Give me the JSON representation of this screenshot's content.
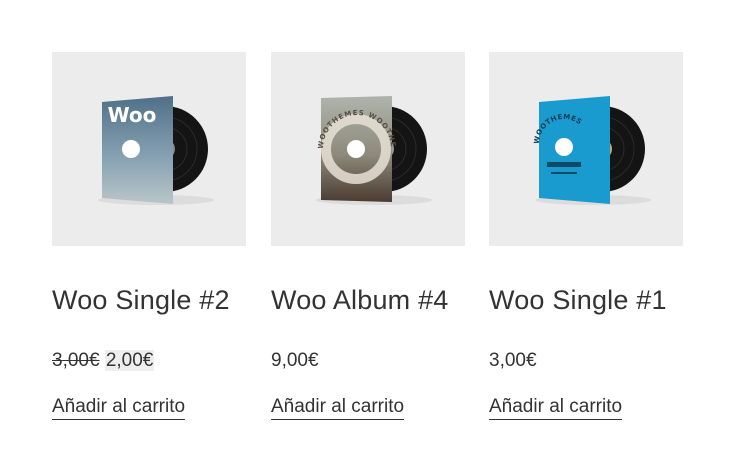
{
  "products": [
    {
      "title": "Woo Single #2",
      "price_regular": "3,00€",
      "price_sale": "2,00€",
      "add_to_cart": "Añadir al carrito",
      "cover_text": "Woo",
      "icon": "vinyl-record-woo-single-2"
    },
    {
      "title": "Woo Album #4",
      "price": "9,00€",
      "add_to_cart": "Añadir al carrito",
      "cover_text": "WOOTHEMES WOOTHEMES",
      "icon": "vinyl-record-woo-album-4"
    },
    {
      "title": "Woo Single #1",
      "price": "3,00€",
      "add_to_cart": "Añadir al carrito",
      "cover_text": "WOOTHEMES",
      "icon": "vinyl-record-woo-single-1"
    }
  ],
  "colors": {
    "thumbnail_bg": "#ececec",
    "text": "#333333",
    "sale_highlight": "#eeeeee",
    "cover_single_2": "#6f8aa0",
    "cover_album_4": "#8a8170",
    "cover_single_1": "#1a9bd0"
  }
}
